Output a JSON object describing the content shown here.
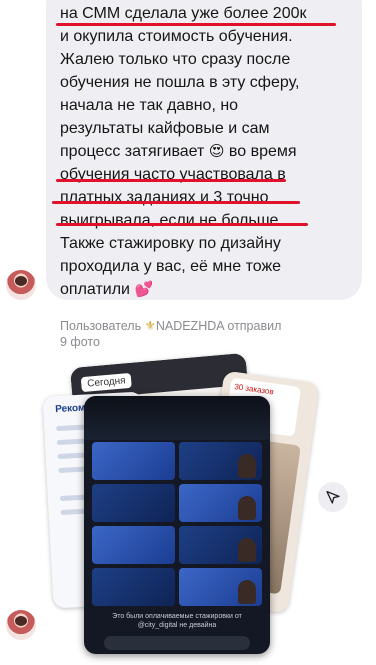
{
  "message": {
    "lines": [
      "на СММ сделала уже более 200к",
      "и окупила стоимость обучения.",
      "Жалею только что сразу после",
      "обучения не пошла в эту сферу,",
      "начала не так давно, но",
      "результаты кайфовые и сам",
      "процесс затягивает",
      "обучения часто участвовала в",
      "платных заданиях и 3 точно",
      "выигрывала, если не больше.",
      "Также стажировку по дизайну",
      "проходила у вас, её мне тоже",
      "оплатили"
    ],
    "line7_tail": "во время",
    "emoji_heart_eyes": "😍",
    "emoji_hearts": "💕",
    "underline_color": "#e0112b"
  },
  "sender": {
    "prefix": "Пользователь",
    "name": "NADEZHDA",
    "action": "отправил",
    "photo_count": "9 фото"
  },
  "photos": {
    "back_tab": "Сегодня",
    "left_title": "Рекоме",
    "promo_text": "30 заказов",
    "front_caption": "Это были оплачиваемые стажировки от",
    "front_caption_sub": "@city_digital не девайна"
  },
  "icons": {
    "share": "share-icon",
    "avatar": "avatar"
  }
}
